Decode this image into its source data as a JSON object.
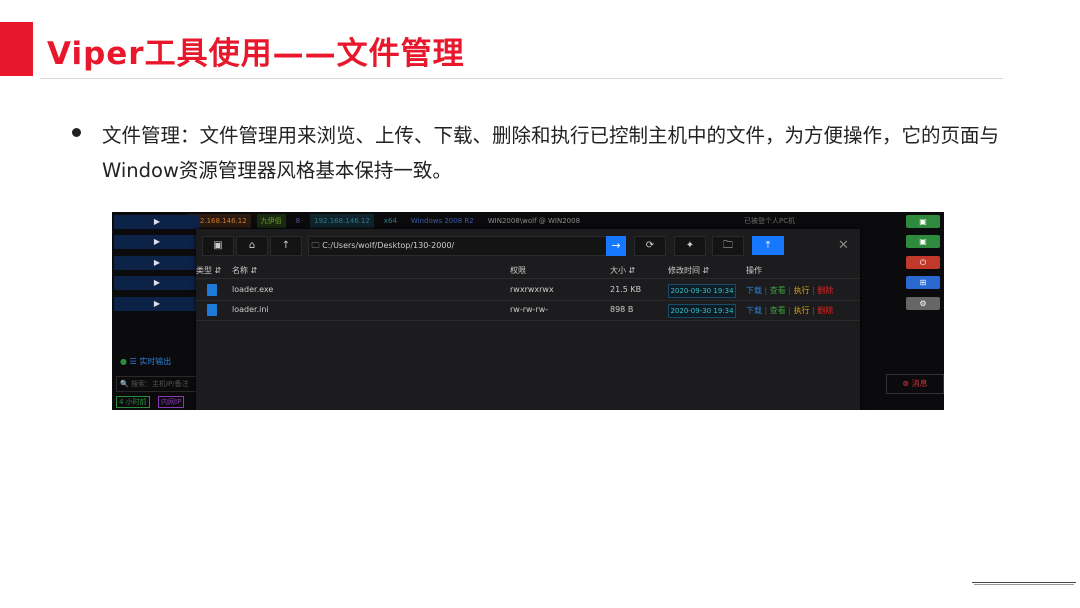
{
  "slide": {
    "title": "Viper工具使用——文件管理",
    "bullet": "文件管理：文件管理用来浏览、上传、下载、删除和执行已控制主机中的文件，为方便操作，它的页面与Window资源管理器风格基本保持一致。"
  },
  "colors": {
    "accent": "#e8172c",
    "primary_btn": "#1677ff",
    "timestamp": "#37c0c8",
    "download": "#2c7fd6",
    "view": "#3ca03c",
    "execute": "#d4a017",
    "delete": "#e02020"
  },
  "screenshot": {
    "host_row": {
      "items": [
        "192.168.146.12",
        "九伊佰",
        "8",
        "192.168.146.12",
        "x64",
        "Windows 2008 R2",
        "WIN2008\\wolf @ WIN2008",
        "已被登个人PC机"
      ]
    },
    "left_play_buttons": [
      "▶",
      "▶",
      "▶",
      "▶",
      "▶"
    ],
    "right_buttons": [
      {
        "icon": "monitor-icon",
        "color": "#2e8b3e"
      },
      {
        "icon": "monitor-icon",
        "color": "#2e8b3e"
      },
      {
        "icon": "power-icon",
        "color": "#c0392b"
      },
      {
        "icon": "windows-icon",
        "color": "#2a6ad0"
      },
      {
        "icon": "settings-icon",
        "color": "#666666"
      }
    ],
    "realtime_output": "实时输出",
    "search_placeholder": "搜索：主机IP/备注",
    "bottom_status": [
      "4 小时前",
      "内网IP"
    ],
    "right_panel_text": "消息",
    "file_manager": {
      "path": "C:/Users/wolf/Desktop/130-2000/",
      "toolbar_icons": [
        "monitor-icon",
        "home-icon",
        "up-arrow-icon",
        "go-arrow-icon",
        "refresh-icon",
        "pin-icon",
        "new-folder-icon",
        "upload-icon",
        "close-icon"
      ],
      "columns": {
        "type": "类型",
        "name": "名称",
        "perm": "权限",
        "size": "大小",
        "mtime": "修改时间",
        "ops": "操作"
      },
      "files": [
        {
          "name": "loader.exe",
          "perm": "rwxrwxrwx",
          "size": "21.5 KB",
          "mtime": "2020-09-30 19:34",
          "ops": [
            "下载",
            "查看",
            "执行",
            "删除"
          ]
        },
        {
          "name": "loader.ini",
          "perm": "rw-rw-rw-",
          "size": "898 B",
          "mtime": "2020-09-30 19:34",
          "ops": [
            "下载",
            "查看",
            "执行",
            "删除"
          ]
        }
      ]
    }
  }
}
